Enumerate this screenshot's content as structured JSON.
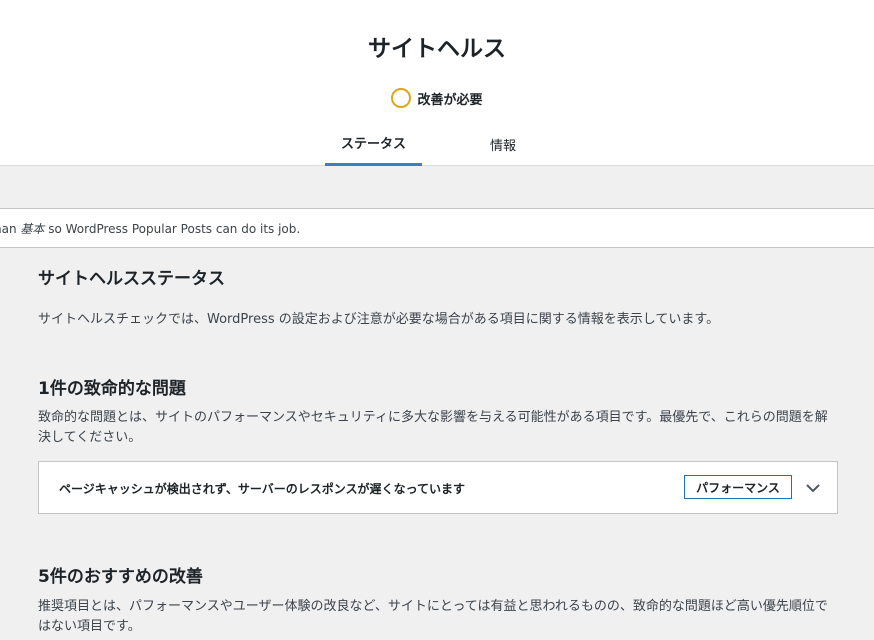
{
  "header": {
    "title": "サイトヘルス",
    "status_label": "改善が必要",
    "status_color": "#dba617",
    "tabs": [
      {
        "label": "ステータス",
        "active": true
      },
      {
        "label": "情報",
        "active": false
      }
    ],
    "active_tab_color": "#3582c4"
  },
  "notice": {
    "text_before": "han ",
    "text_em": "基本",
    "text_after": " so WordPress Popular Posts can do its job."
  },
  "main": {
    "title": "サイトヘルスステータス",
    "description": "サイトヘルスチェックでは、WordPress の設定および注意が必要な場合がある項目に関する情報を表示しています。",
    "critical": {
      "title": "1件の致命的な問題",
      "description": "致命的な問題とは、サイトのパフォーマンスやセキュリティに多大な影響を与える可能性がある項目です。最優先で、これらの問題を解決してください。",
      "issues": [
        {
          "label": "ページキャッシュが検出されず、サーバーのレスポンスが遅くなっています",
          "badge": "パフォーマンス",
          "expand_icon": "chevron-down-icon"
        }
      ]
    },
    "recommended": {
      "title": "5件のおすすめの改善",
      "description": "推奨項目とは、パフォーマンスやユーザー体験の改良など、サイトにとっては有益と思われるものの、致命的な問題ほど高い優先順位ではない項目です。"
    }
  }
}
